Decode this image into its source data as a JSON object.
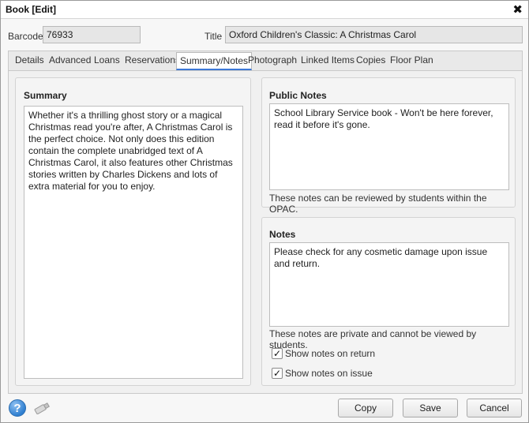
{
  "window": {
    "title": "Book [Edit]",
    "close_glyph": "✖"
  },
  "header": {
    "barcode_label": "Barcode",
    "barcode_value": "76933",
    "title_label": "Title",
    "title_value": "Oxford Children's Classic: A Christmas Carol"
  },
  "tabs": [
    {
      "label": "Details"
    },
    {
      "label": "Advanced"
    },
    {
      "label": "Loans"
    },
    {
      "label": "Reservations"
    },
    {
      "label": "Summary/Notes",
      "active": true
    },
    {
      "label": "Photograph"
    },
    {
      "label": "Linked Items"
    },
    {
      "label": "Copies"
    },
    {
      "label": "Floor Plan"
    }
  ],
  "summary": {
    "title": "Summary",
    "text": "Whether it's a thrilling ghost story or a magical Christmas read you're after, A Christmas Carol is the perfect choice. Not only does this edition contain the complete unabridged text of A Christmas Carol, it also features other Christmas stories written by Charles Dickens and lots of extra material for you to enjoy."
  },
  "public_notes": {
    "title": "Public Notes",
    "text": "School Library Service book - Won't be here forever, read it before it's gone.",
    "hint": "These notes can be reviewed by students within the OPAC."
  },
  "notes": {
    "title": "Notes",
    "text": "Please check for any cosmetic damage upon issue and return.",
    "hint": "These notes are private and cannot be viewed by students.",
    "show_on_return": {
      "label": "Show notes on return",
      "checked": true
    },
    "show_on_issue": {
      "label": "Show notes on issue",
      "checked": true
    }
  },
  "footer": {
    "help_icon": "question-circle-icon",
    "usb_icon": "usb-drive-icon",
    "copy_label": "Copy",
    "save_label": "Save",
    "cancel_label": "Cancel"
  },
  "colors": {
    "accent": "#3b78d8",
    "help_blue": "#2f7fd0"
  }
}
